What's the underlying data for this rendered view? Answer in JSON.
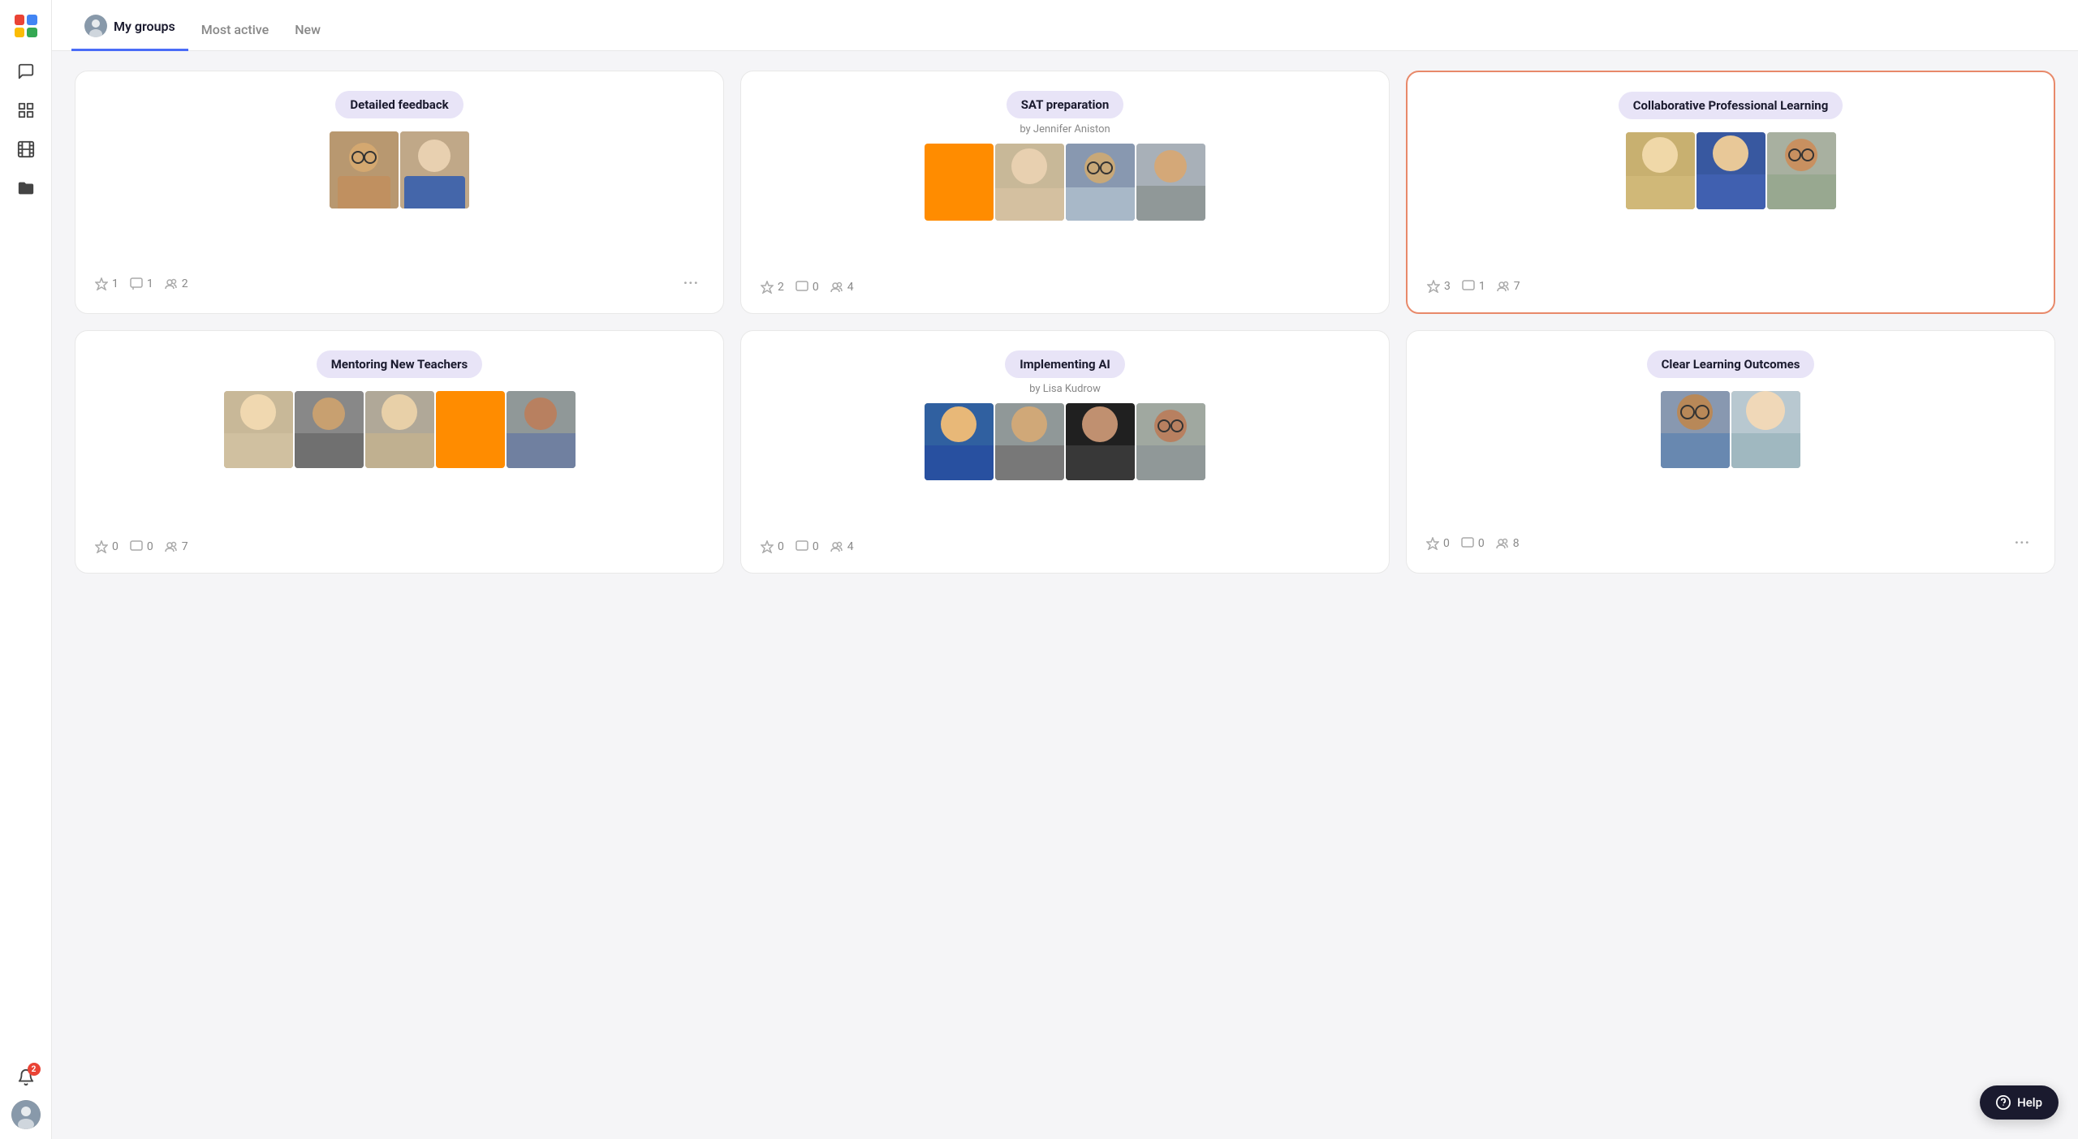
{
  "sidebar": {
    "logo_alt": "App Logo",
    "icons": [
      {
        "name": "chat-icon",
        "label": "Chat"
      },
      {
        "name": "grid-icon",
        "label": "Grid"
      },
      {
        "name": "film-icon",
        "label": "Media"
      },
      {
        "name": "folder-icon",
        "label": "Files"
      }
    ],
    "notification_count": "2",
    "user_avatar_alt": "User Avatar"
  },
  "tabs": {
    "items": [
      {
        "id": "my-groups",
        "label": "My groups",
        "active": true,
        "has_avatar": true
      },
      {
        "id": "most-active",
        "label": "Most active",
        "active": false,
        "has_avatar": false
      },
      {
        "id": "new",
        "label": "New",
        "active": false,
        "has_avatar": false
      }
    ]
  },
  "groups": [
    {
      "id": "detailed-feedback",
      "title": "Detailed feedback",
      "subtitle": "",
      "highlighted": false,
      "photos": [
        "person-curly",
        "person-woman-1"
      ],
      "stars": 1,
      "comments": 1,
      "members": 2,
      "has_more": true
    },
    {
      "id": "sat-preparation",
      "title": "SAT preparation",
      "subtitle": "by Jennifer Aniston",
      "highlighted": false,
      "photos": [
        "orange-square",
        "person-woman-2",
        "person-glasses",
        "person-man-1"
      ],
      "stars": 2,
      "comments": 0,
      "members": 4,
      "has_more": false
    },
    {
      "id": "collaborative-professional-learning",
      "title": "Collaborative Professional Learning",
      "subtitle": "",
      "highlighted": true,
      "photos": [
        "person-blonde",
        "person-woman-3",
        "person-man-dark"
      ],
      "stars": 3,
      "comments": 1,
      "members": 7,
      "has_more": false
    },
    {
      "id": "mentoring-new-teachers",
      "title": "Mentoring New Teachers",
      "subtitle": "",
      "highlighted": false,
      "photos": [
        "person-w1",
        "person-m1",
        "person-w2",
        "orange-sq2",
        "person-m2"
      ],
      "stars": 0,
      "comments": 0,
      "members": 7,
      "has_more": false
    },
    {
      "id": "implementing-ai",
      "title": "Implementing AI",
      "subtitle": "by Lisa Kudrow",
      "highlighted": false,
      "photos": [
        "person-w3",
        "person-m3",
        "person-m4",
        "person-m5"
      ],
      "stars": 0,
      "comments": 0,
      "members": 4,
      "has_more": false
    },
    {
      "id": "clear-learning-outcomes",
      "title": "Clear Learning Outcomes",
      "subtitle": "",
      "highlighted": false,
      "photos": [
        "person-m6",
        "person-w4"
      ],
      "stars": 0,
      "comments": 0,
      "members": 8,
      "has_more": true
    }
  ],
  "help": {
    "label": "Help"
  }
}
